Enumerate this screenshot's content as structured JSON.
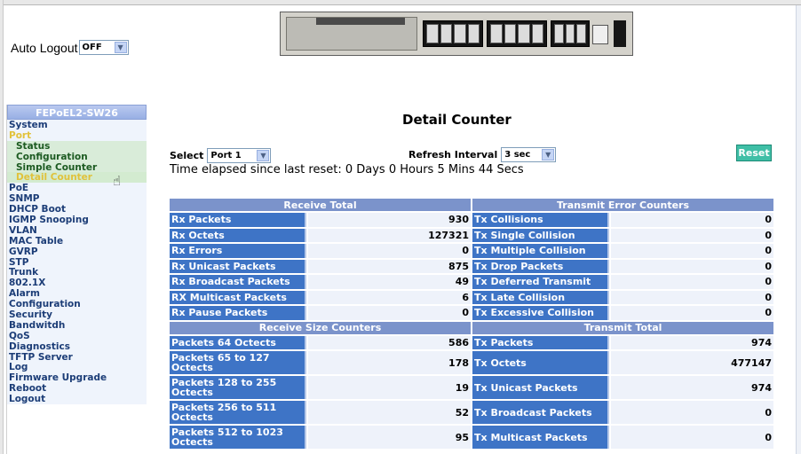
{
  "auto_logout": {
    "label": "Auto Logout",
    "value": "OFF"
  },
  "sidebar": {
    "title": "FEPoEL2-SW26",
    "items": [
      {
        "label": "System",
        "sub": false,
        "active": false
      },
      {
        "label": "Port",
        "sub": false,
        "active": true
      },
      {
        "label": "Status",
        "sub": true,
        "active": false
      },
      {
        "label": "Configuration",
        "sub": true,
        "active": false
      },
      {
        "label": "Simple Counter",
        "sub": true,
        "active": false
      },
      {
        "label": "Detail Counter",
        "sub": true,
        "active": true
      },
      {
        "label": "PoE",
        "sub": false,
        "active": false
      },
      {
        "label": "SNMP",
        "sub": false,
        "active": false
      },
      {
        "label": "DHCP Boot",
        "sub": false,
        "active": false
      },
      {
        "label": "IGMP Snooping",
        "sub": false,
        "active": false
      },
      {
        "label": "VLAN",
        "sub": false,
        "active": false
      },
      {
        "label": "MAC Table",
        "sub": false,
        "active": false
      },
      {
        "label": "GVRP",
        "sub": false,
        "active": false
      },
      {
        "label": "STP",
        "sub": false,
        "active": false
      },
      {
        "label": "Trunk",
        "sub": false,
        "active": false
      },
      {
        "label": "802.1X",
        "sub": false,
        "active": false
      },
      {
        "label": "Alarm",
        "sub": false,
        "active": false
      },
      {
        "label": "Configuration",
        "sub": false,
        "active": false
      },
      {
        "label": "Security",
        "sub": false,
        "active": false
      },
      {
        "label": "Bandwitdh",
        "sub": false,
        "active": false
      },
      {
        "label": "QoS",
        "sub": false,
        "active": false
      },
      {
        "label": "Diagnostics",
        "sub": false,
        "active": false
      },
      {
        "label": "TFTP Server",
        "sub": false,
        "active": false
      },
      {
        "label": "Log",
        "sub": false,
        "active": false
      },
      {
        "label": "Firmware Upgrade",
        "sub": false,
        "active": false
      },
      {
        "label": "Reboot",
        "sub": false,
        "active": false
      },
      {
        "label": "Logout",
        "sub": false,
        "active": false
      }
    ]
  },
  "main": {
    "title": "Detail Counter",
    "select_label": "Select",
    "select_value": "Port 1",
    "refresh_label": "Refresh Interval",
    "refresh_value": "3 sec",
    "reset_label": "Reset",
    "elapsed": "Time elapsed since last reset: 0 Days 0 Hours 5 Mins 44 Secs"
  },
  "table": {
    "sections": [
      {
        "left_header": "Receive Total",
        "right_header": "Transmit Error Counters",
        "rows": [
          {
            "l_label": "Rx Packets",
            "l_value": "930",
            "r_label": "Tx Collisions",
            "r_value": "0"
          },
          {
            "l_label": "Rx Octets",
            "l_value": "127321",
            "r_label": "Tx Single Collision",
            "r_value": "0"
          },
          {
            "l_label": "Rx Errors",
            "l_value": "0",
            "r_label": "Tx Multiple Collision",
            "r_value": "0"
          },
          {
            "l_label": "Rx Unicast Packets",
            "l_value": "875",
            "r_label": "Tx Drop Packets",
            "r_value": "0"
          },
          {
            "l_label": "Rx Broadcast Packets",
            "l_value": "49",
            "r_label": "Tx Deferred Transmit",
            "r_value": "0"
          },
          {
            "l_label": "RX Multicast Packets",
            "l_value": "6",
            "r_label": "Tx Late Collision",
            "r_value": "0"
          },
          {
            "l_label": "Rx Pause Packets",
            "l_value": "0",
            "r_label": "Tx Excessive Collision",
            "r_value": "0"
          }
        ]
      },
      {
        "left_header": "Receive Size Counters",
        "right_header": "Transmit Total",
        "rows": [
          {
            "l_label": "Packets 64 Octects",
            "l_value": "586",
            "r_label": "Tx Packets",
            "r_value": "974",
            "tall": false
          },
          {
            "l_label": "Packets 65 to 127 Octects",
            "l_value": "178",
            "r_label": "Tx Octets",
            "r_value": "477147",
            "tall": true
          },
          {
            "l_label": "Packets 128 to 255 Octects",
            "l_value": "19",
            "r_label": "Tx Unicast Packets",
            "r_value": "974",
            "tall": true
          },
          {
            "l_label": "Packets 256 to 511 Octects",
            "l_value": "52",
            "r_label": "Tx Broadcast Packets",
            "r_value": "0",
            "tall": true
          },
          {
            "l_label": "Packets 512 to 1023 Octects",
            "l_value": "95",
            "r_label": "Tx Multicast Packets",
            "r_value": "0",
            "tall": true
          }
        ]
      }
    ]
  }
}
